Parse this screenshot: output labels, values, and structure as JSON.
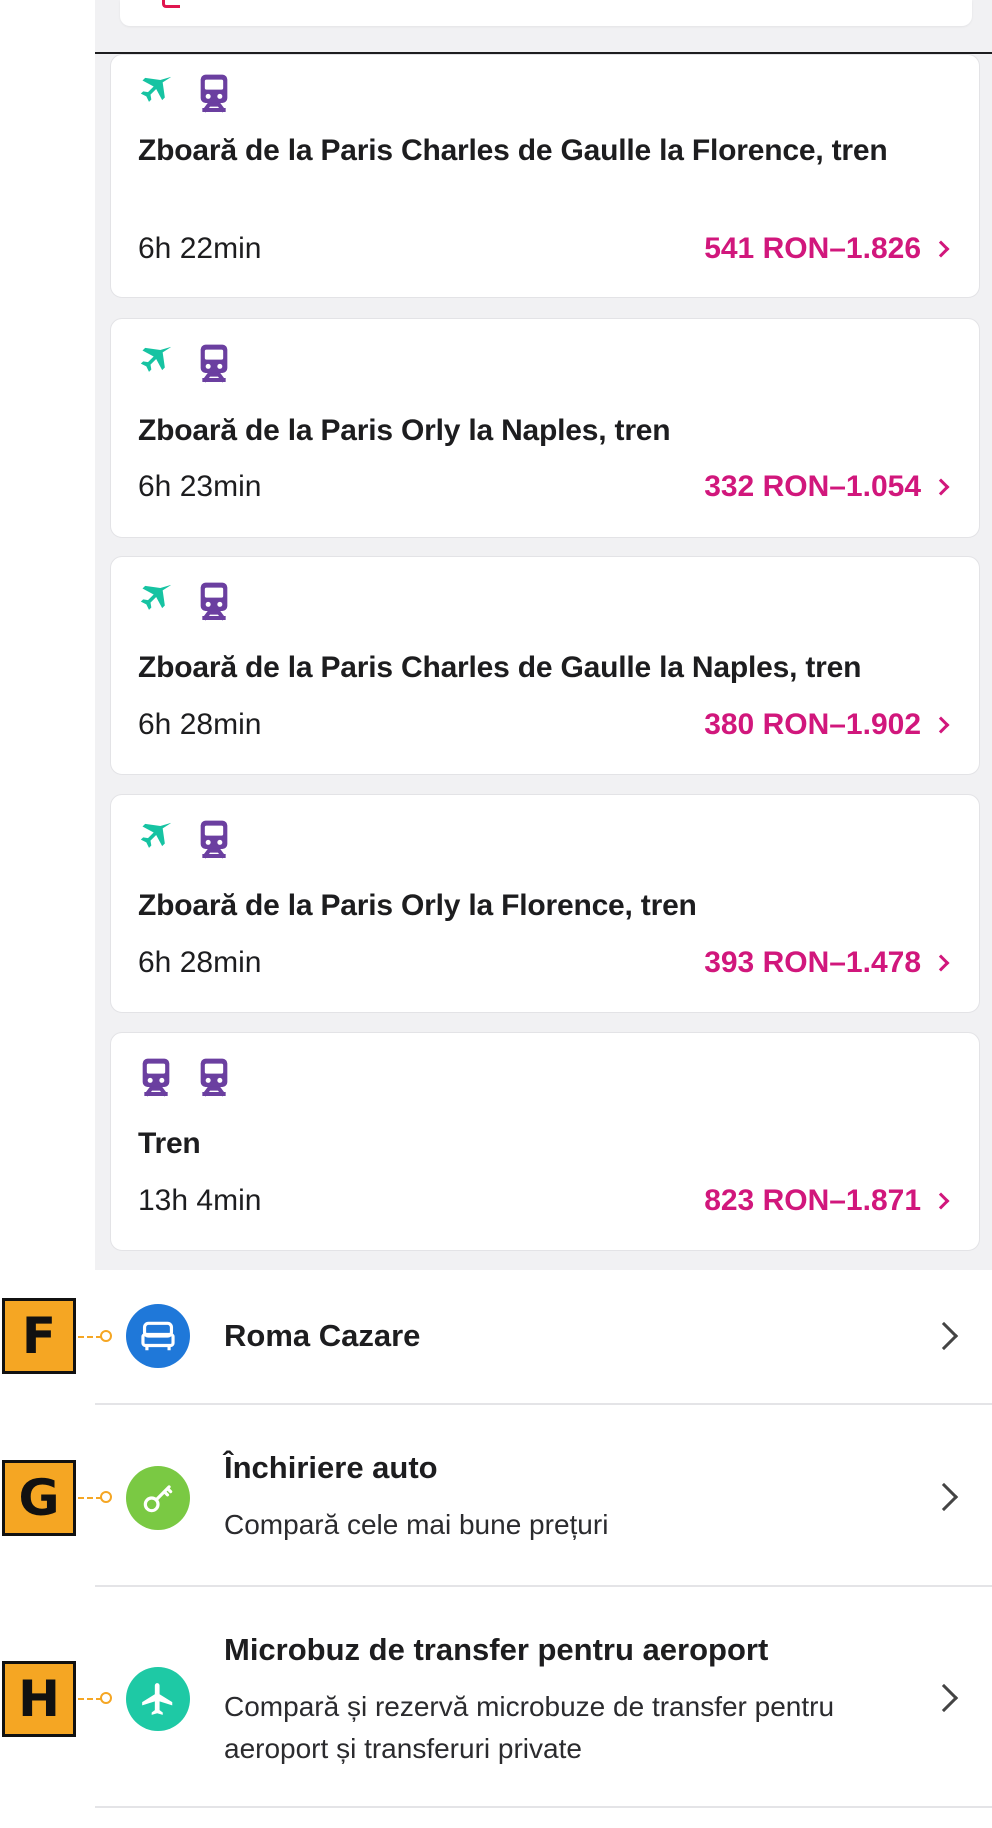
{
  "colors": {
    "accent_price": "#d1177c",
    "plane": "#16c3a2",
    "train": "#6b3fa0",
    "bed_circle": "#1f78d9",
    "key_circle": "#7ac943",
    "plane_circle": "#1ec9a5",
    "badge": "#f5a623"
  },
  "routes": [
    {
      "icons": [
        "plane-icon",
        "train-icon"
      ],
      "title": "Zboară de la Paris Charles de Gaulle la Florence, tren",
      "duration": "6h 22min",
      "price": "541 RON–1.826"
    },
    {
      "icons": [
        "plane-icon",
        "train-icon"
      ],
      "title": "Zboară de la Paris Orly la Naples, tren",
      "duration": "6h 23min",
      "price": "332 RON–1.054"
    },
    {
      "icons": [
        "plane-icon",
        "train-icon"
      ],
      "title": "Zboară de la Paris Charles de Gaulle la Naples, tren",
      "duration": "6h 28min",
      "price": "380 RON–1.902"
    },
    {
      "icons": [
        "plane-icon",
        "train-icon"
      ],
      "title": "Zboară de la Paris Orly la Florence, tren",
      "duration": "6h 28min",
      "price": "393 RON–1.478"
    },
    {
      "icons": [
        "train-icon",
        "train-icon"
      ],
      "title": "Tren",
      "duration": "13h 4min",
      "price": "823 RON–1.871"
    }
  ],
  "services": [
    {
      "badge": "F",
      "icon": "bed-icon",
      "title": "Roma Cazare",
      "subtitle": ""
    },
    {
      "badge": "G",
      "icon": "key-icon",
      "title": "Închiriere auto",
      "subtitle": "Compară cele mai bune prețuri"
    },
    {
      "badge": "H",
      "icon": "plane-icon",
      "title": "Microbuz de transfer pentru aeroport",
      "subtitle": "Compară și rezervă microbuze de transfer pentru aeroport și transferuri private"
    }
  ]
}
